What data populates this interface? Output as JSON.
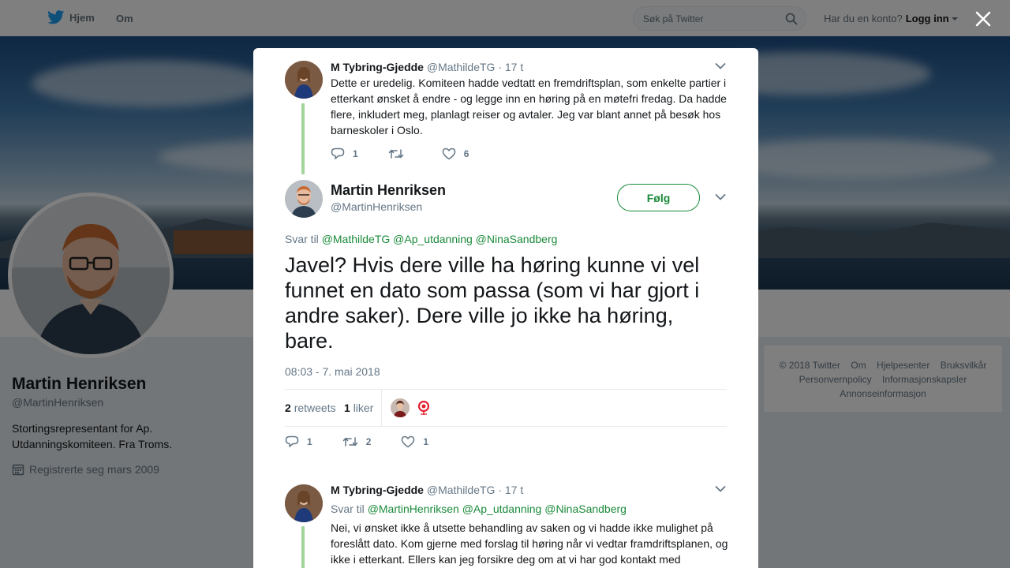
{
  "topbar": {
    "home_label": "Hjem",
    "about_label": "Om",
    "search_placeholder": "Søk på Twitter",
    "account_question": "Har du en konto?",
    "login_label": "Logg inn"
  },
  "profile": {
    "name": "Martin Henriksen",
    "handle": "@MartinHenriksen",
    "bio": "Stortingsrepresentant for Ap. Utdanningskomiteen. Fra Troms.",
    "joined": "Registrerte seg mars 2009"
  },
  "footer": {
    "links": [
      "© 2018 Twitter",
      "Om",
      "Hjelpesenter",
      "Bruksvilkår",
      "Personvernpolicy",
      "Informasjonskapsler",
      "Annonseinformasjon"
    ]
  },
  "colors": {
    "accent": "#1a8a3a",
    "thread_line": "#a3d49b",
    "muted": "#657786"
  },
  "tweet1": {
    "name": "M Tybring-Gjedde",
    "handle": "@MathildeTG",
    "time": "· 17 t",
    "text": "Dette er uredelig. Komiteen hadde vedtatt en fremdriftsplan, som enkelte partier i etterkant ønsket å endre - og legge inn en høring på en møtefri fredag. Da hadde flere, inkludert meg, planlagt reiser og avtaler. Jeg var blant annet på besøk hos barneskoler i Oslo.",
    "replies": "1",
    "likes": "6"
  },
  "main": {
    "name": "Martin Henriksen",
    "handle": "@MartinHenriksen",
    "follow_label": "Følg",
    "reply_prefix": "Svar til",
    "mentions": [
      "@MathildeTG",
      "@Ap_utdanning",
      "@NinaSandberg"
    ],
    "text": "Javel? Hvis dere ville ha høring kunne vi vel funnet en dato som passa (som vi har gjort i andre saker). Dere ville jo ikke ha høring, bare.",
    "date": "08:03 - 7. mai 2018",
    "retweets_count": "2",
    "retweets_label": "retweets",
    "likes_count": "1",
    "likes_label": "liker",
    "replies": "1",
    "retweets": "2",
    "likes": "1"
  },
  "tweet3": {
    "name": "M Tybring-Gjedde",
    "handle": "@MathildeTG",
    "time": "· 17 t",
    "reply_prefix": "Svar til",
    "mentions": [
      "@MartinHenriksen",
      "@Ap_utdanning",
      "@NinaSandberg"
    ],
    "text": "Nei, vi ønsket ikke å utsette behandling av saken og vi hadde ikke mulighet på foreslått dato. Kom gjerne med forslag til høring når vi vedtar framdriftsplanen, og ikke i etterkant. Ellers kan jeg forsikre deg om at vi har god kontakt med"
  }
}
